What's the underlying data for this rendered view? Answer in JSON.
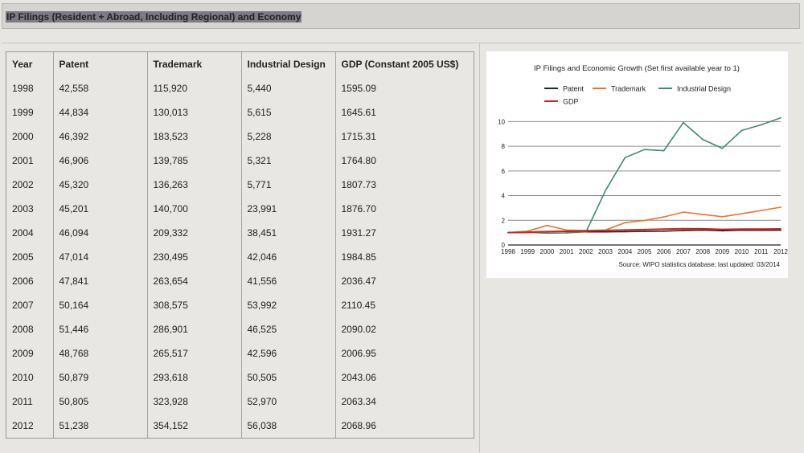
{
  "page_title": "IP Filings (Resident + Abroad, Including Regional) and Economy",
  "table": {
    "headers": [
      "Year",
      "Patent",
      "Trademark",
      "Industrial Design",
      "GDP (Constant 2005 US$)"
    ],
    "rows": [
      [
        "1998",
        "42,558",
        "115,920",
        "5,440",
        "1595.09"
      ],
      [
        "1999",
        "44,834",
        "130,013",
        "5,615",
        "1645.61"
      ],
      [
        "2000",
        "46,392",
        "183,523",
        "5,228",
        "1715.31"
      ],
      [
        "2001",
        "46,906",
        "139,785",
        "5,321",
        "1764.80"
      ],
      [
        "2002",
        "45,320",
        "136,263",
        "5,771",
        "1807.73"
      ],
      [
        "2003",
        "45,201",
        "140,700",
        "23,991",
        "1876.70"
      ],
      [
        "2004",
        "46,094",
        "209,332",
        "38,451",
        "1931.27"
      ],
      [
        "2005",
        "47,014",
        "230,495",
        "42,046",
        "1984.85"
      ],
      [
        "2006",
        "47,841",
        "263,654",
        "41,556",
        "2036.47"
      ],
      [
        "2007",
        "50,164",
        "308,575",
        "53,992",
        "2110.45"
      ],
      [
        "2008",
        "51,446",
        "286,901",
        "46,525",
        "2090.02"
      ],
      [
        "2009",
        "48,768",
        "265,517",
        "42,596",
        "2006.95"
      ],
      [
        "2010",
        "50,879",
        "293,618",
        "50,505",
        "2043.06"
      ],
      [
        "2011",
        "50,805",
        "323,928",
        "52,970",
        "2063.34"
      ],
      [
        "2012",
        "51,238",
        "354,152",
        "56,038",
        "2068.96"
      ]
    ]
  },
  "chart_data": {
    "type": "line",
    "title": "IP Filings and Economic Growth (Set first available year to 1)",
    "source": "Source: WIPO statistics database; last updated: 03/2014",
    "x": [
      "1998",
      "1999",
      "2000",
      "2001",
      "2002",
      "2003",
      "2004",
      "2005",
      "2006",
      "2007",
      "2008",
      "2009",
      "2010",
      "2011",
      "2012"
    ],
    "yticks": [
      "0",
      "2",
      "4",
      "6",
      "8",
      "10"
    ],
    "ylim": [
      0,
      11
    ],
    "grid": true,
    "legend_position": "top",
    "series": [
      {
        "name": "Patent",
        "color": "#1f2a2a",
        "values": [
          1.0,
          1.05,
          1.09,
          1.1,
          1.06,
          1.06,
          1.08,
          1.1,
          1.12,
          1.18,
          1.21,
          1.15,
          1.2,
          1.19,
          1.2
        ]
      },
      {
        "name": "Trademark",
        "color": "#e8772e",
        "values": [
          1.0,
          1.12,
          1.58,
          1.21,
          1.18,
          1.21,
          1.81,
          1.99,
          2.27,
          2.66,
          2.48,
          2.29,
          2.53,
          2.79,
          3.06
        ]
      },
      {
        "name": "Industrial Design",
        "color": "#3e8a78",
        "values": [
          1.0,
          1.03,
          0.96,
          0.98,
          1.06,
          4.41,
          7.07,
          7.73,
          7.64,
          9.92,
          8.55,
          7.83,
          9.28,
          9.74,
          10.3
        ]
      },
      {
        "name": "GDP",
        "color": "#d42020",
        "values": [
          1.0,
          1.03,
          1.08,
          1.11,
          1.13,
          1.18,
          1.21,
          1.24,
          1.28,
          1.32,
          1.31,
          1.26,
          1.28,
          1.29,
          1.3
        ]
      }
    ]
  }
}
